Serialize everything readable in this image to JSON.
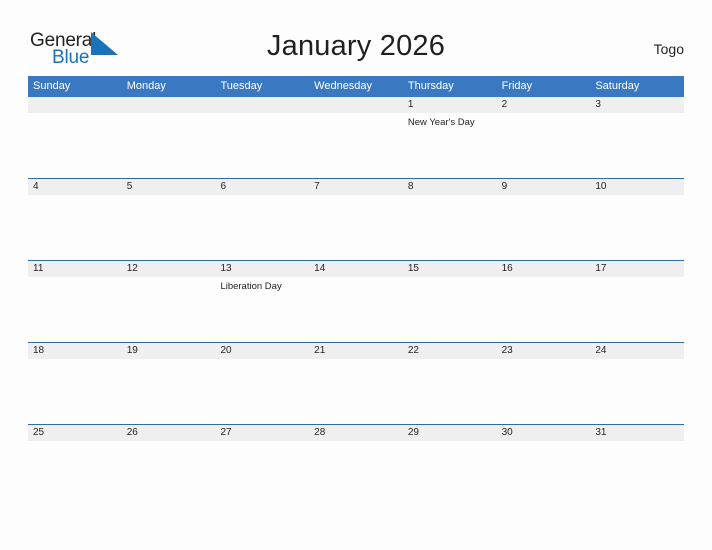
{
  "brand": {
    "name_part1": "General",
    "name_part2": "Blue",
    "flag_color": "#1b72b8",
    "logo_icon": "flag-triangle-icon"
  },
  "header": {
    "title": "January 2026",
    "country": "Togo"
  },
  "theme": {
    "header_blue": "#3a79c1",
    "rule_blue": "#2e6da4",
    "band_gray": "#efefef",
    "text_dark": "#231f20",
    "page_background": "#fdfdfd"
  },
  "calendar": {
    "weekdays": [
      "Sunday",
      "Monday",
      "Tuesday",
      "Wednesday",
      "Thursday",
      "Friday",
      "Saturday"
    ],
    "weeks": [
      {
        "days": [
          {
            "num": "",
            "event": ""
          },
          {
            "num": "",
            "event": ""
          },
          {
            "num": "",
            "event": ""
          },
          {
            "num": "",
            "event": ""
          },
          {
            "num": "1",
            "event": "New Year's Day"
          },
          {
            "num": "2",
            "event": ""
          },
          {
            "num": "3",
            "event": ""
          }
        ]
      },
      {
        "days": [
          {
            "num": "4",
            "event": ""
          },
          {
            "num": "5",
            "event": ""
          },
          {
            "num": "6",
            "event": ""
          },
          {
            "num": "7",
            "event": ""
          },
          {
            "num": "8",
            "event": ""
          },
          {
            "num": "9",
            "event": ""
          },
          {
            "num": "10",
            "event": ""
          }
        ]
      },
      {
        "days": [
          {
            "num": "11",
            "event": ""
          },
          {
            "num": "12",
            "event": ""
          },
          {
            "num": "13",
            "event": "Liberation Day"
          },
          {
            "num": "14",
            "event": ""
          },
          {
            "num": "15",
            "event": ""
          },
          {
            "num": "16",
            "event": ""
          },
          {
            "num": "17",
            "event": ""
          }
        ]
      },
      {
        "days": [
          {
            "num": "18",
            "event": ""
          },
          {
            "num": "19",
            "event": ""
          },
          {
            "num": "20",
            "event": ""
          },
          {
            "num": "21",
            "event": ""
          },
          {
            "num": "22",
            "event": ""
          },
          {
            "num": "23",
            "event": ""
          },
          {
            "num": "24",
            "event": ""
          }
        ]
      },
      {
        "days": [
          {
            "num": "25",
            "event": ""
          },
          {
            "num": "26",
            "event": ""
          },
          {
            "num": "27",
            "event": ""
          },
          {
            "num": "28",
            "event": ""
          },
          {
            "num": "29",
            "event": ""
          },
          {
            "num": "30",
            "event": ""
          },
          {
            "num": "31",
            "event": ""
          }
        ]
      }
    ]
  }
}
